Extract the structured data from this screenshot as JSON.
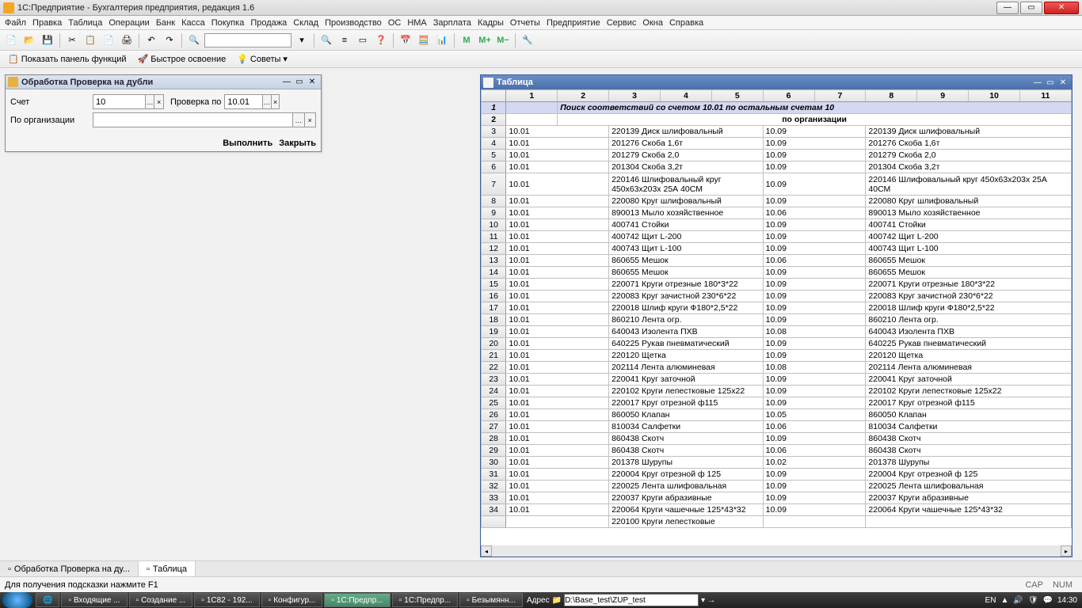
{
  "window": {
    "title": "1С:Предприятие - Бухгалтерия предприятия, редакция 1.6"
  },
  "menu": [
    "Файл",
    "Правка",
    "Таблица",
    "Операции",
    "Банк",
    "Касса",
    "Покупка",
    "Продажа",
    "Склад",
    "Производство",
    "ОС",
    "НМА",
    "Зарплата",
    "Кадры",
    "Отчеты",
    "Предприятие",
    "Сервис",
    "Окна",
    "Справка"
  ],
  "toolbar2": {
    "panel": "Показать панель функций",
    "quick": "Быстрое освоение",
    "tips": "Советы"
  },
  "dialog": {
    "title": "Обработка  Проверка на дубли",
    "account_label": "Счет",
    "account_value": "10",
    "check_label": "Проверка по",
    "check_value": "10.01",
    "org_label": "По организации",
    "org_value": "",
    "run": "Выполнить",
    "close": "Закрыть"
  },
  "table_window": {
    "title": "Таблица",
    "col_headers": [
      "1",
      "2",
      "3",
      "4",
      "5",
      "6",
      "7",
      "8",
      "9",
      "10",
      "11"
    ],
    "title_row": "Поиск соответствий со счетом 10.01 по остальным счетам 10",
    "org_row": "по организации",
    "rows": [
      {
        "n": "3",
        "a": "10.01",
        "b": "220139 Диск шлифовальный",
        "c": "10.09",
        "d": "220139 Диск шлифовальный"
      },
      {
        "n": "4",
        "a": "10.01",
        "b": "201276 Скоба 1,6т",
        "c": "10.09",
        "d": "201276 Скоба 1,6т"
      },
      {
        "n": "5",
        "a": "10.01",
        "b": "201279 Скоба 2,0",
        "c": "10.09",
        "d": "201279 Скоба 2,0"
      },
      {
        "n": "6",
        "a": "10.01",
        "b": "201304 Скоба 3,2т",
        "c": "10.09",
        "d": "201304 Скоба 3,2т"
      },
      {
        "n": "7",
        "a": "10.01",
        "b": "220146 Шлифовальный круг 450х63х203х 25А 40СМ",
        "c": "10.09",
        "d": "220146 Шлифовальный круг 450х63х203х 25А 40СМ"
      },
      {
        "n": "8",
        "a": "10.01",
        "b": "220080 Круг шлифовальный",
        "c": "10.09",
        "d": "220080 Круг шлифовальный"
      },
      {
        "n": "9",
        "a": "10.01",
        "b": "890013 Мыло хозяйственное",
        "c": "10.06",
        "d": "890013 Мыло хозяйственное"
      },
      {
        "n": "10",
        "a": "10.01",
        "b": "400741 Стойки",
        "c": "10.09",
        "d": "400741 Стойки"
      },
      {
        "n": "11",
        "a": "10.01",
        "b": "400742 Щит L-200",
        "c": "10.09",
        "d": "400742 Щит L-200"
      },
      {
        "n": "12",
        "a": "10.01",
        "b": "400743 Щит L-100",
        "c": "10.09",
        "d": "400743 Щит L-100"
      },
      {
        "n": "13",
        "a": "10.01",
        "b": "860655 Мешок",
        "c": "10.06",
        "d": "860655 Мешок"
      },
      {
        "n": "14",
        "a": "10.01",
        "b": "860655 Мешок",
        "c": "10.09",
        "d": "860655 Мешок"
      },
      {
        "n": "15",
        "a": "10.01",
        "b": "220071 Круги отрезные 180*3*22",
        "c": "10.09",
        "d": "220071 Круги отрезные 180*3*22"
      },
      {
        "n": "16",
        "a": "10.01",
        "b": "220083 Круг зачистной 230*6*22",
        "c": "10.09",
        "d": "220083 Круг зачистной 230*6*22"
      },
      {
        "n": "17",
        "a": "10.01",
        "b": "220018 Шлиф круги Ф180*2,5*22",
        "c": "10.09",
        "d": "220018 Шлиф круги Ф180*2,5*22"
      },
      {
        "n": "18",
        "a": "10.01",
        "b": "860210 Лента огр.",
        "c": "10.09",
        "d": "860210 Лента огр."
      },
      {
        "n": "19",
        "a": "10.01",
        "b": "640043 Изолента  ПХВ",
        "c": "10.08",
        "d": "640043 Изолента  ПХВ"
      },
      {
        "n": "20",
        "a": "10.01",
        "b": "640225 Рукав пневматический",
        "c": "10.09",
        "d": "640225 Рукав пневматический"
      },
      {
        "n": "21",
        "a": "10.01",
        "b": "220120 Щетка",
        "c": "10.09",
        "d": "220120 Щетка"
      },
      {
        "n": "22",
        "a": "10.01",
        "b": "202114 Лента алюминевая",
        "c": "10.08",
        "d": "202114 Лента алюминевая"
      },
      {
        "n": "23",
        "a": "10.01",
        "b": "220041 Круг заточной",
        "c": "10.09",
        "d": "220041 Круг заточной"
      },
      {
        "n": "24",
        "a": "10.01",
        "b": "220102 Круги лепестковые 125х22",
        "c": "10.09",
        "d": "220102 Круги лепестковые 125х22"
      },
      {
        "n": "25",
        "a": "10.01",
        "b": "220017 Круг отрезной ф115",
        "c": "10.09",
        "d": "220017 Круг отрезной ф115"
      },
      {
        "n": "26",
        "a": "10.01",
        "b": "860050 Клапан",
        "c": "10.05",
        "d": "860050 Клапан"
      },
      {
        "n": "27",
        "a": "10.01",
        "b": "810034 Салфетки",
        "c": "10.06",
        "d": "810034 Салфетки"
      },
      {
        "n": "28",
        "a": "10.01",
        "b": "860438 Скотч",
        "c": "10.09",
        "d": "860438 Скотч"
      },
      {
        "n": "29",
        "a": "10.01",
        "b": "860438 Скотч",
        "c": "10.06",
        "d": "860438 Скотч"
      },
      {
        "n": "30",
        "a": "10.01",
        "b": "201378 Шурупы",
        "c": "10.02",
        "d": "201378 Шурупы"
      },
      {
        "n": "31",
        "a": "10.01",
        "b": "220004 Круг отрезной ф 125",
        "c": "10.09",
        "d": "220004 Круг отрезной ф 125"
      },
      {
        "n": "32",
        "a": "10.01",
        "b": "220025 Лента шлифовальная",
        "c": "10.09",
        "d": "220025 Лента шлифовальная"
      },
      {
        "n": "33",
        "a": "10.01",
        "b": "220037 Круги абразивные",
        "c": "10.09",
        "d": "220037 Круги абразивные"
      },
      {
        "n": "34",
        "a": "10.01",
        "b": "220064 Круги чашечные 125*43*32",
        "c": "10.09",
        "d": "220064 Круги чашечные 125*43*32"
      },
      {
        "n": "",
        "a": "",
        "b": "220100 Круги лепестковые",
        "c": "",
        "d": ""
      }
    ]
  },
  "wintabs": [
    "Обработка  Проверка на ду...",
    "Таблица"
  ],
  "statusbar": {
    "hint": "Для получения подсказки нажмите F1",
    "cap": "CAP",
    "num": "NUM"
  },
  "taskbar": {
    "apps": [
      "Входящие ...",
      "Создание ...",
      "1С82 - 192...",
      "Конфигур...",
      "1С:Предпр...",
      "1С:Предпр...",
      "Безымянн..."
    ],
    "addr_label": "Адрес",
    "addr_value": "D:\\Base_test\\ZUP_test",
    "lang": "EN",
    "time": "14:30"
  }
}
